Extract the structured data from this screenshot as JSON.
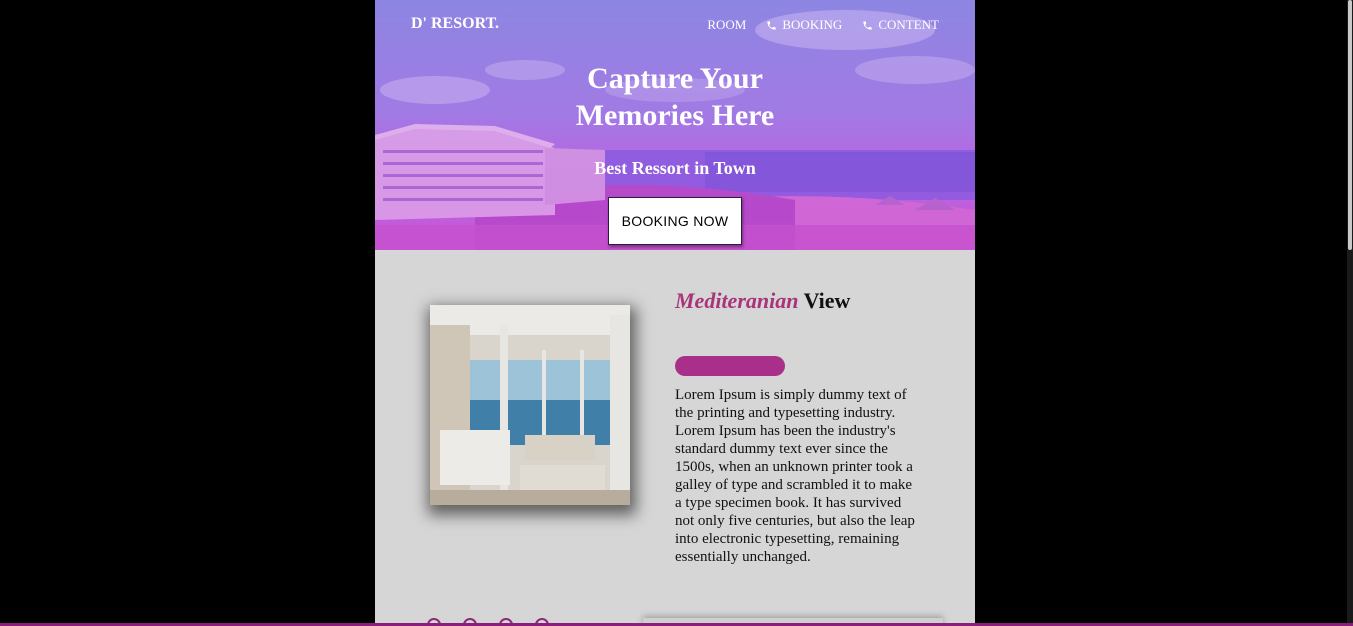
{
  "brand": "D' RESORT.",
  "nav": {
    "room": "ROOM",
    "booking": "BOOKING",
    "content": "CONTENT"
  },
  "hero": {
    "title_line1": "Capture Your",
    "title_line2": "Memories Here",
    "subtitle": "Best Ressort in Town",
    "cta": "BOOKING NOW"
  },
  "room": {
    "title_em": "Mediteranian",
    "title_rest": " View",
    "description": "Lorem Ipsum is simply dummy text of the printing and typesetting industry. Lorem Ipsum has been the industry's standard dummy text ever since the 1500s, when an unknown printer took a galley of type and scrambled it to make a type specimen book. It has survived not only five centuries, but also the leap into electronic typesetting, remaining essentially unchanged."
  },
  "colors": {
    "accent": "#a8308a",
    "title_accent": "#a8347a",
    "page_bg": "#d6d6d6",
    "outer_bg": "#000000"
  },
  "icons": [
    "phone-icon",
    "phone-icon"
  ]
}
